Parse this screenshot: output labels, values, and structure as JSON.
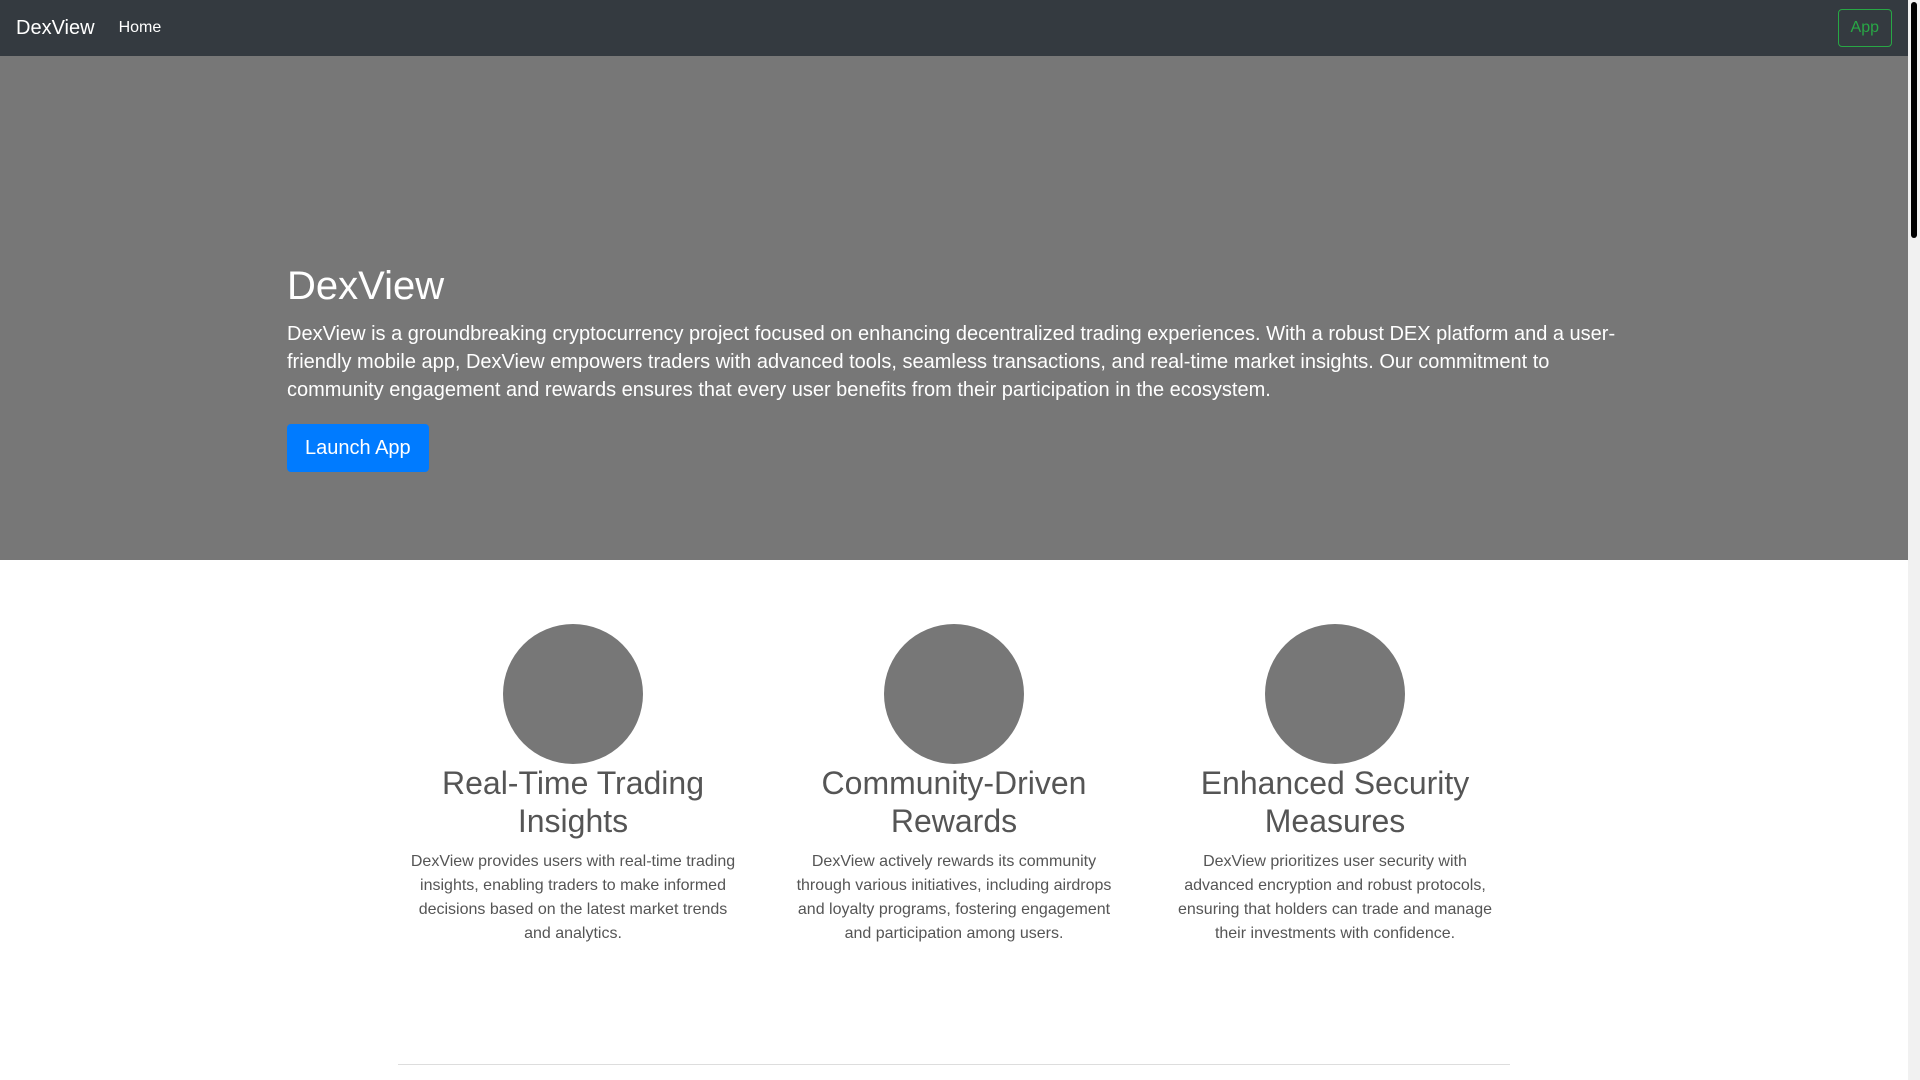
{
  "navbar": {
    "brand": "DexView",
    "links": [
      "Home"
    ],
    "app_button": "App",
    "background": "#343a40"
  },
  "hero": {
    "title": "DexView",
    "lead": "DexView is a groundbreaking cryptocurrency project focused on enhancing decentralized trading experiences. With a robust DEX platform and a user-friendly mobile app, DexView empowers traders with advanced tools, seamless transactions, and real-time market insights. Our commitment to community engagement and rewards ensures that every user benefits from their participation in the ecosystem.",
    "cta": "Launch App",
    "background": "#777777",
    "cta_color": "#007bff"
  },
  "features": [
    {
      "title": "Real-Time Trading Insights",
      "text": "DexView provides users with real-time trading insights, enabling traders to make informed decisions based on the latest market trends and analytics."
    },
    {
      "title": "Community-Driven Rewards",
      "text": "DexView actively rewards its community through various initiatives, including airdrops and loyalty programs, fostering engagement and participation among users."
    },
    {
      "title": "Enhanced Security Measures",
      "text": "DexView prioritizes user security with advanced encryption and robust protocols, ensuring that holders can trade and manage their investments with confidence."
    }
  ]
}
